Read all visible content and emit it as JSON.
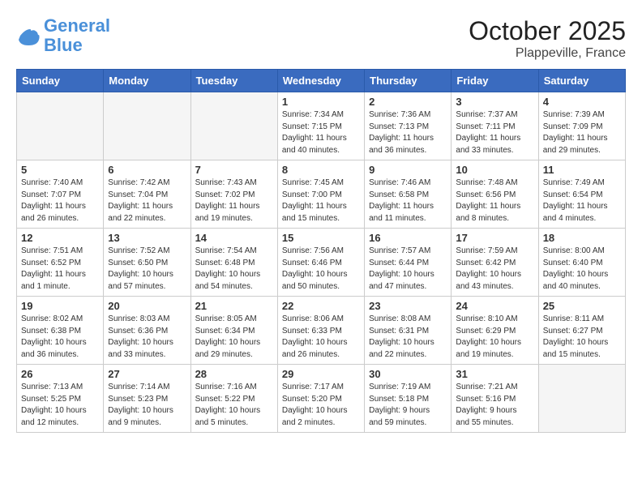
{
  "logo": {
    "line1": "General",
    "line2": "Blue"
  },
  "title": "October 2025",
  "location": "Plappeville, France",
  "weekdays": [
    "Sunday",
    "Monday",
    "Tuesday",
    "Wednesday",
    "Thursday",
    "Friday",
    "Saturday"
  ],
  "weeks": [
    [
      {
        "day": "",
        "info": ""
      },
      {
        "day": "",
        "info": ""
      },
      {
        "day": "",
        "info": ""
      },
      {
        "day": "1",
        "info": "Sunrise: 7:34 AM\nSunset: 7:15 PM\nDaylight: 11 hours\nand 40 minutes."
      },
      {
        "day": "2",
        "info": "Sunrise: 7:36 AM\nSunset: 7:13 PM\nDaylight: 11 hours\nand 36 minutes."
      },
      {
        "day": "3",
        "info": "Sunrise: 7:37 AM\nSunset: 7:11 PM\nDaylight: 11 hours\nand 33 minutes."
      },
      {
        "day": "4",
        "info": "Sunrise: 7:39 AM\nSunset: 7:09 PM\nDaylight: 11 hours\nand 29 minutes."
      }
    ],
    [
      {
        "day": "5",
        "info": "Sunrise: 7:40 AM\nSunset: 7:07 PM\nDaylight: 11 hours\nand 26 minutes."
      },
      {
        "day": "6",
        "info": "Sunrise: 7:42 AM\nSunset: 7:04 PM\nDaylight: 11 hours\nand 22 minutes."
      },
      {
        "day": "7",
        "info": "Sunrise: 7:43 AM\nSunset: 7:02 PM\nDaylight: 11 hours\nand 19 minutes."
      },
      {
        "day": "8",
        "info": "Sunrise: 7:45 AM\nSunset: 7:00 PM\nDaylight: 11 hours\nand 15 minutes."
      },
      {
        "day": "9",
        "info": "Sunrise: 7:46 AM\nSunset: 6:58 PM\nDaylight: 11 hours\nand 11 minutes."
      },
      {
        "day": "10",
        "info": "Sunrise: 7:48 AM\nSunset: 6:56 PM\nDaylight: 11 hours\nand 8 minutes."
      },
      {
        "day": "11",
        "info": "Sunrise: 7:49 AM\nSunset: 6:54 PM\nDaylight: 11 hours\nand 4 minutes."
      }
    ],
    [
      {
        "day": "12",
        "info": "Sunrise: 7:51 AM\nSunset: 6:52 PM\nDaylight: 11 hours\nand 1 minute."
      },
      {
        "day": "13",
        "info": "Sunrise: 7:52 AM\nSunset: 6:50 PM\nDaylight: 10 hours\nand 57 minutes."
      },
      {
        "day": "14",
        "info": "Sunrise: 7:54 AM\nSunset: 6:48 PM\nDaylight: 10 hours\nand 54 minutes."
      },
      {
        "day": "15",
        "info": "Sunrise: 7:56 AM\nSunset: 6:46 PM\nDaylight: 10 hours\nand 50 minutes."
      },
      {
        "day": "16",
        "info": "Sunrise: 7:57 AM\nSunset: 6:44 PM\nDaylight: 10 hours\nand 47 minutes."
      },
      {
        "day": "17",
        "info": "Sunrise: 7:59 AM\nSunset: 6:42 PM\nDaylight: 10 hours\nand 43 minutes."
      },
      {
        "day": "18",
        "info": "Sunrise: 8:00 AM\nSunset: 6:40 PM\nDaylight: 10 hours\nand 40 minutes."
      }
    ],
    [
      {
        "day": "19",
        "info": "Sunrise: 8:02 AM\nSunset: 6:38 PM\nDaylight: 10 hours\nand 36 minutes."
      },
      {
        "day": "20",
        "info": "Sunrise: 8:03 AM\nSunset: 6:36 PM\nDaylight: 10 hours\nand 33 minutes."
      },
      {
        "day": "21",
        "info": "Sunrise: 8:05 AM\nSunset: 6:34 PM\nDaylight: 10 hours\nand 29 minutes."
      },
      {
        "day": "22",
        "info": "Sunrise: 8:06 AM\nSunset: 6:33 PM\nDaylight: 10 hours\nand 26 minutes."
      },
      {
        "day": "23",
        "info": "Sunrise: 8:08 AM\nSunset: 6:31 PM\nDaylight: 10 hours\nand 22 minutes."
      },
      {
        "day": "24",
        "info": "Sunrise: 8:10 AM\nSunset: 6:29 PM\nDaylight: 10 hours\nand 19 minutes."
      },
      {
        "day": "25",
        "info": "Sunrise: 8:11 AM\nSunset: 6:27 PM\nDaylight: 10 hours\nand 15 minutes."
      }
    ],
    [
      {
        "day": "26",
        "info": "Sunrise: 7:13 AM\nSunset: 5:25 PM\nDaylight: 10 hours\nand 12 minutes."
      },
      {
        "day": "27",
        "info": "Sunrise: 7:14 AM\nSunset: 5:23 PM\nDaylight: 10 hours\nand 9 minutes."
      },
      {
        "day": "28",
        "info": "Sunrise: 7:16 AM\nSunset: 5:22 PM\nDaylight: 10 hours\nand 5 minutes."
      },
      {
        "day": "29",
        "info": "Sunrise: 7:17 AM\nSunset: 5:20 PM\nDaylight: 10 hours\nand 2 minutes."
      },
      {
        "day": "30",
        "info": "Sunrise: 7:19 AM\nSunset: 5:18 PM\nDaylight: 9 hours\nand 59 minutes."
      },
      {
        "day": "31",
        "info": "Sunrise: 7:21 AM\nSunset: 5:16 PM\nDaylight: 9 hours\nand 55 minutes."
      },
      {
        "day": "",
        "info": ""
      }
    ]
  ]
}
